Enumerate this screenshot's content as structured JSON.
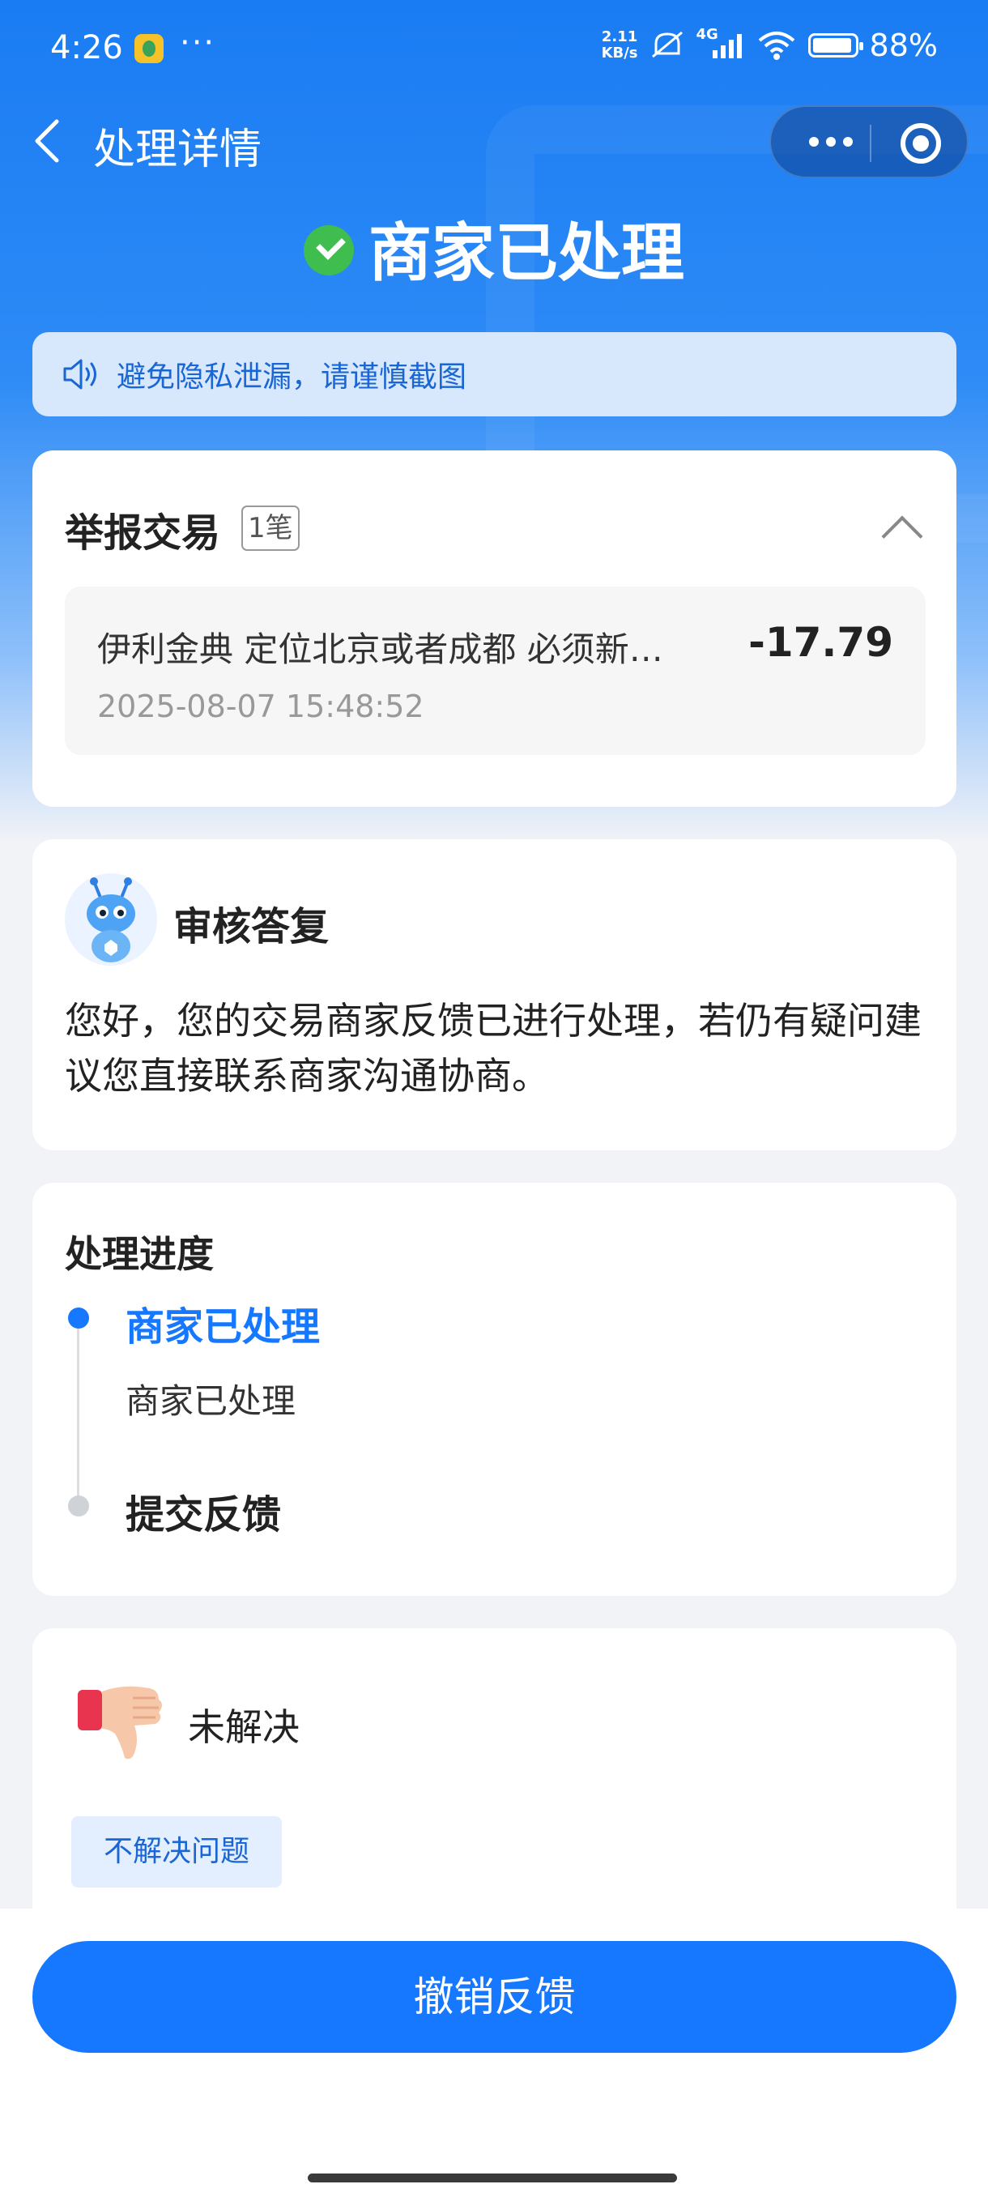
{
  "status_bar": {
    "time": "4:26",
    "more": "···",
    "net_speed": "2.11",
    "net_unit": "KB/s",
    "signal": "4G",
    "battery": "88%"
  },
  "nav": {
    "title": "处理详情"
  },
  "status": {
    "title": "商家已处理"
  },
  "notice": {
    "text": "避免隐私泄漏，请谨慎截图"
  },
  "report": {
    "title": "举报交易",
    "count_badge": "1笔",
    "transaction": {
      "name": "伊利金典 定位北京或者成都 必须新…",
      "amount": "-17.79",
      "time": "2025-08-07 15:48:52"
    }
  },
  "review": {
    "title": "审核答复",
    "body": "您好，您的交易商家反馈已进行处理，若仍有疑问建议您直接联系商家沟通协商。"
  },
  "progress": {
    "title": "处理进度",
    "steps": [
      {
        "label": "商家已处理",
        "desc": "商家已处理"
      },
      {
        "label": "提交反馈"
      }
    ]
  },
  "feedback": {
    "status": "未解决",
    "tag": "不解决问题"
  },
  "actions": {
    "cancel_label": "撤销反馈"
  },
  "colors": {
    "primary": "#1677ff",
    "success": "#3fbd4f"
  }
}
